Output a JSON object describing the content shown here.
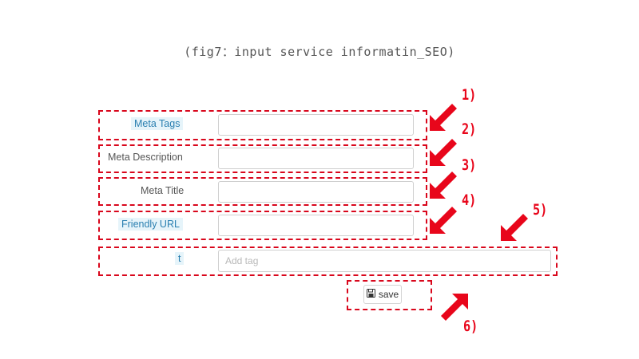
{
  "caption": "(fig7：input service informatin_SEO)",
  "form": {
    "meta_tags_label": "Meta Tags",
    "meta_description_label": "Meta Description",
    "meta_title_label": "Meta Title",
    "friendly_url_label": "Friendly URL",
    "tags_label": "t",
    "tags_placeholder": "Add tag",
    "save_label": "save"
  },
  "annotations": {
    "n1": "1)",
    "n2": "2)",
    "n3": "3)",
    "n4": "4)",
    "n5": "5)",
    "n6": "6)",
    "color": "#e8061b"
  }
}
